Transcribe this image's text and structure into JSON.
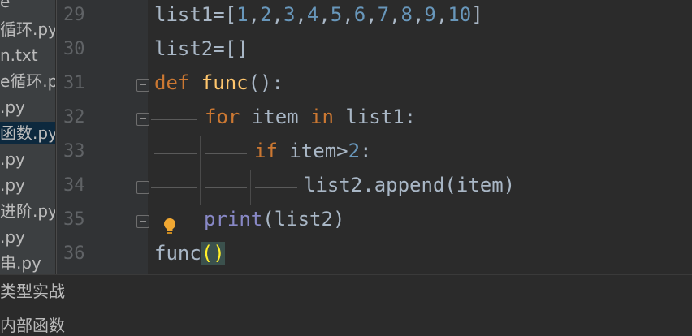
{
  "sidebar": {
    "files": [
      "e",
      "循环.py",
      "n.txt",
      "e循环.py",
      ".py",
      "函数.py",
      ".py",
      ".py",
      "进阶.py",
      ".py",
      "串.py"
    ]
  },
  "bottom_panel": {
    "line1": "类型实战",
    "line2": "内部函数"
  },
  "editor": {
    "line_numbers": [
      "29",
      "30",
      "31",
      "32",
      "33",
      "34",
      "35",
      "36"
    ],
    "lines": [
      [
        {
          "t": "list1=[",
          "c": "plain"
        },
        {
          "t": "1",
          "c": "num"
        },
        {
          "t": ",",
          "c": "plain"
        },
        {
          "t": "2",
          "c": "num"
        },
        {
          "t": ",",
          "c": "plain"
        },
        {
          "t": "3",
          "c": "num"
        },
        {
          "t": ",",
          "c": "plain"
        },
        {
          "t": "4",
          "c": "num"
        },
        {
          "t": ",",
          "c": "plain"
        },
        {
          "t": "5",
          "c": "num"
        },
        {
          "t": ",",
          "c": "plain"
        },
        {
          "t": "6",
          "c": "num"
        },
        {
          "t": ",",
          "c": "plain"
        },
        {
          "t": "7",
          "c": "num"
        },
        {
          "t": ",",
          "c": "plain"
        },
        {
          "t": "8",
          "c": "num"
        },
        {
          "t": ",",
          "c": "plain"
        },
        {
          "t": "9",
          "c": "num"
        },
        {
          "t": ",",
          "c": "plain"
        },
        {
          "t": "10",
          "c": "num"
        },
        {
          "t": "]",
          "c": "plain"
        }
      ],
      [
        {
          "t": "list2=[]",
          "c": "plain"
        }
      ],
      [
        {
          "t": "def ",
          "c": "kw"
        },
        {
          "t": "func",
          "c": "fn"
        },
        {
          "t": "():",
          "c": "plain"
        }
      ],
      [
        {
          "t": "for ",
          "c": "kw"
        },
        {
          "t": "item ",
          "c": "plain"
        },
        {
          "t": "in ",
          "c": "kw"
        },
        {
          "t": "list1:",
          "c": "plain"
        }
      ],
      [
        {
          "t": "if ",
          "c": "kw"
        },
        {
          "t": "item>",
          "c": "plain"
        },
        {
          "t": "2",
          "c": "num"
        },
        {
          "t": ":",
          "c": "plain"
        }
      ],
      [
        {
          "t": "list2.append(item)",
          "c": "plain"
        }
      ],
      [
        {
          "t": "print",
          "c": "bi"
        },
        {
          "t": "(list2)",
          "c": "plain"
        }
      ],
      [
        {
          "t": "func",
          "c": "plain"
        },
        {
          "t": "()",
          "c": "brace-hl"
        }
      ]
    ]
  }
}
